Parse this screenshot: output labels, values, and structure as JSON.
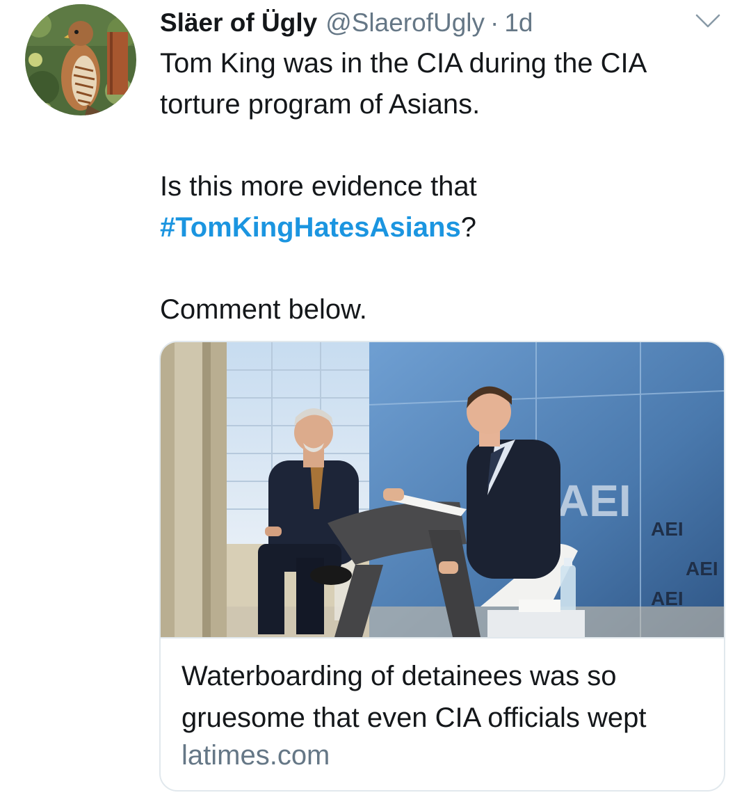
{
  "tweet": {
    "display_name": "Släer of Ügly",
    "handle": "@SlaerofUgly",
    "separator": "·",
    "time": "1d",
    "lines": {
      "p1": "Tom King was in the CIA during the CIA torture program of Asians.",
      "p2_before": "Is this more evidence that",
      "hashtag": "#TomKingHatesAsians",
      "p2_after": "?",
      "p3": "Comment below."
    },
    "avatar_icon": "hawk-avatar",
    "menu_icon": "chevron-down-icon"
  },
  "card": {
    "title": "Waterboarding of detainees was so gruesome that even CIA officials wept",
    "domain": "latimes.com",
    "image_logo_text": "AEI"
  },
  "colors": {
    "text": "#14171a",
    "secondary": "#657786",
    "link": "#1b95e0",
    "border": "#e1e8ed"
  }
}
